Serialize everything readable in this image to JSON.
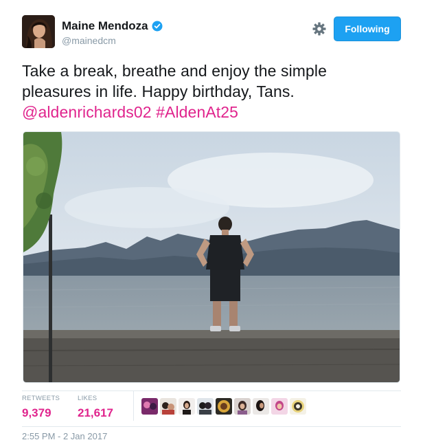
{
  "user": {
    "display_name": "Maine Mendoza",
    "handle": "@mainedcm",
    "verified_icon": "verified-badge-icon"
  },
  "actions": {
    "settings_icon": "gear-icon",
    "follow_label": "Following"
  },
  "tweet": {
    "line1": "Take a break, breathe and enjoy the simple",
    "line2": "pleasures in life. Happy birthday, Tans.",
    "mention": "@aldenrichards02",
    "hashtag": "#AldenAt25"
  },
  "stats": {
    "retweets_label": "RETWEETS",
    "retweets_value": "9,379",
    "likes_label": "LIKES",
    "likes_value": "21,617"
  },
  "likers_count_shown": 9,
  "timestamp": "2:55 PM - 2 Jan 2017",
  "colors": {
    "accent": "#1da1f2",
    "link": "#e0248d",
    "muted": "#8899a6",
    "text": "#14171a"
  }
}
